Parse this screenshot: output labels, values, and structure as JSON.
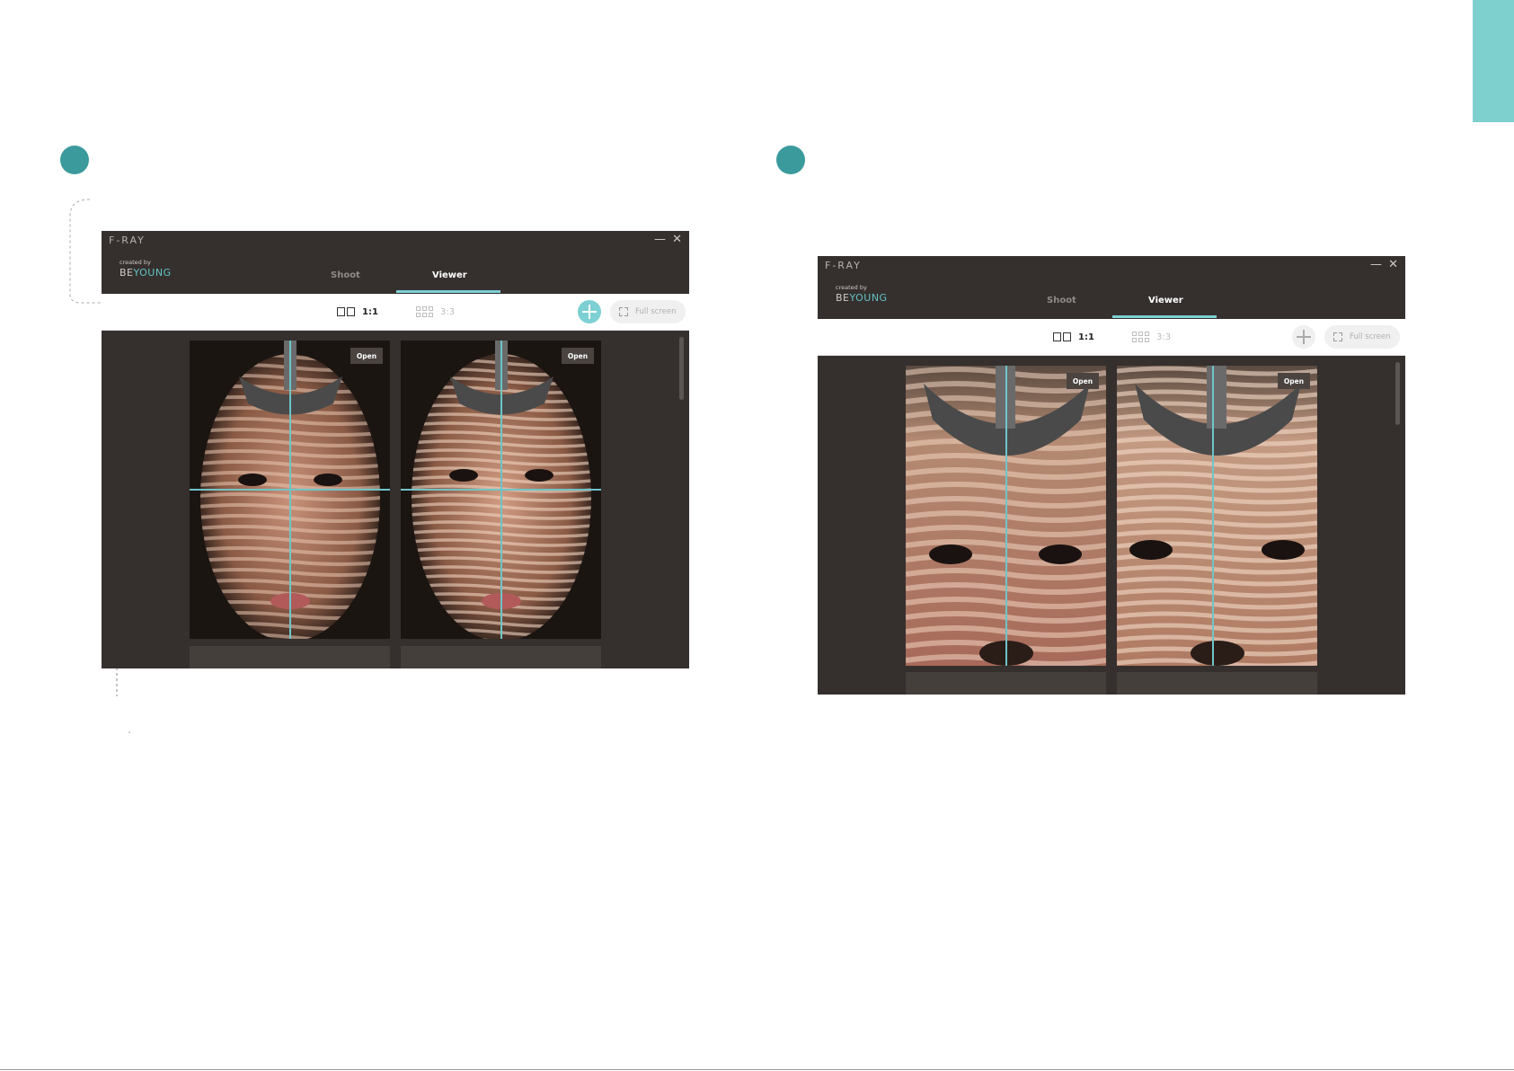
{
  "app": {
    "title": "F-RAY",
    "brand_small": "created by",
    "brand_name_a": "BE",
    "brand_name_b": "YOUNG",
    "minimize_icon": "—",
    "close_icon": "✕"
  },
  "tabs": {
    "shoot": "Shoot",
    "viewer": "Viewer"
  },
  "toolbar": {
    "layout_1x1_label": "1:1",
    "layout_3x3_label": "3:3",
    "full_screen_label": "Full screen"
  },
  "photos": {
    "open_label": "Open"
  },
  "colors": {
    "accent": "#7dd0d4",
    "step_dot": "#3a9a9c",
    "window_bg": "#35302e",
    "side_tab": "#7ed0ce"
  },
  "icons": [
    "layout-1x1-icon",
    "layout-3x3-icon",
    "crosshair-icon",
    "fullscreen-icon",
    "minimize-icon",
    "close-icon"
  ]
}
